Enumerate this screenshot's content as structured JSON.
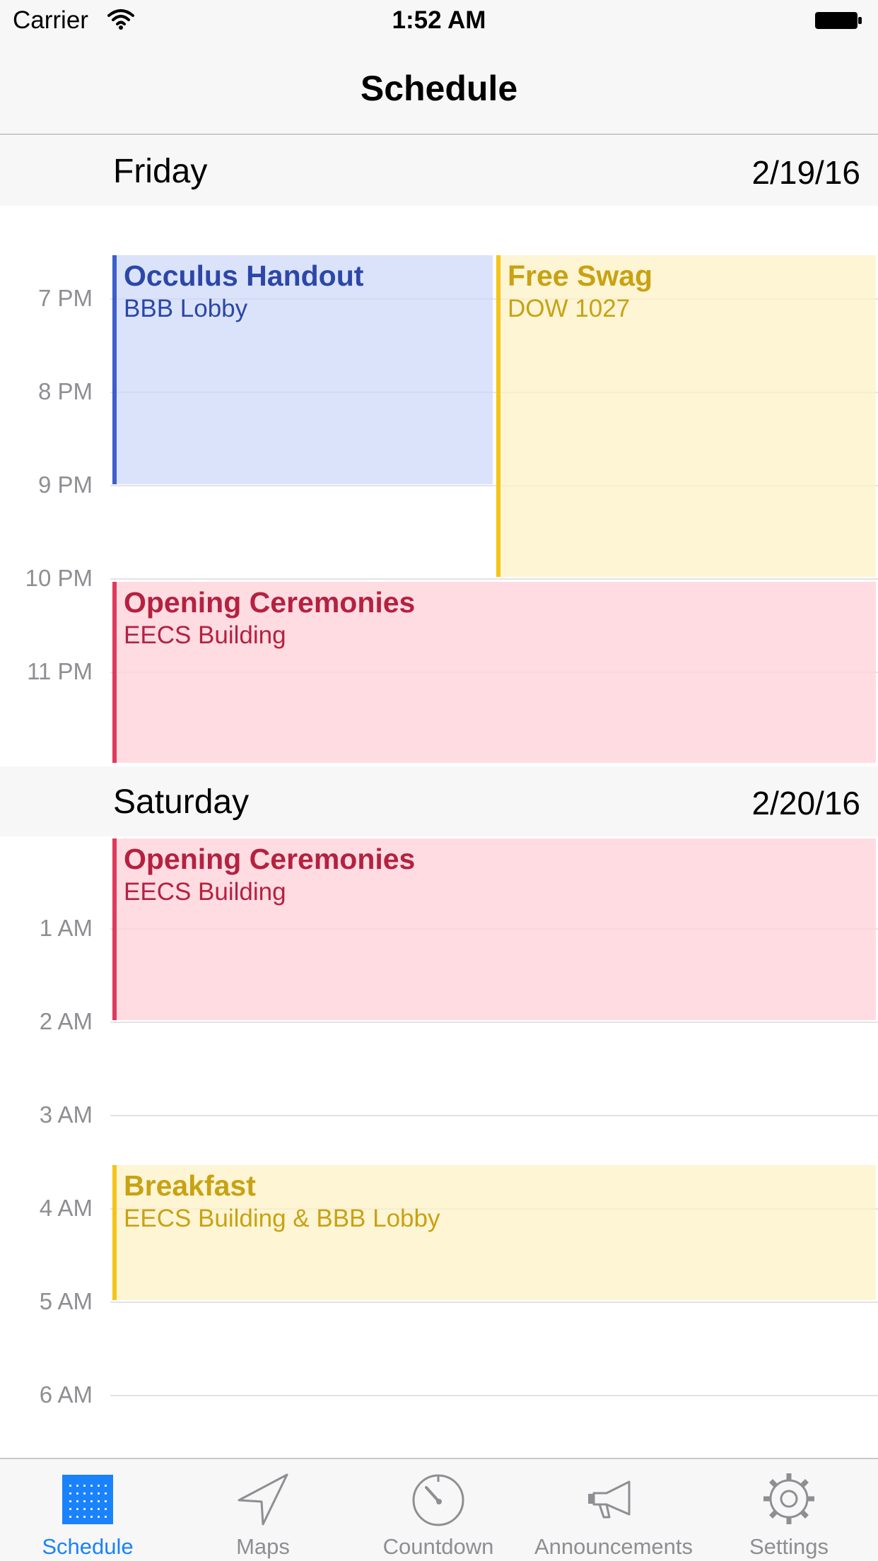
{
  "status_bar": {
    "carrier": "Carrier",
    "time": "1:52 AM"
  },
  "nav": {
    "title": "Schedule"
  },
  "days": [
    {
      "name": "Friday",
      "date": "2/19/16"
    },
    {
      "name": "Saturday",
      "date": "2/20/16"
    }
  ],
  "time_labels": [
    "7 PM",
    "8 PM",
    "9 PM",
    "10 PM",
    "11 PM",
    "1 AM",
    "2 AM",
    "3 AM",
    "4 AM",
    "5 AM",
    "6 AM"
  ],
  "events": [
    {
      "title": "Occulus Handout",
      "location": "BBB Lobby",
      "color": "#3c5fca"
    },
    {
      "title": "Free Swag",
      "location": "DOW 1027",
      "color": "#f4c419"
    },
    {
      "title": "Opening Ceremonies",
      "location": "EECS Building",
      "color": "#de3a5c"
    },
    {
      "title": "Opening Ceremonies",
      "location": "EECS Building",
      "color": "#de3a5c"
    },
    {
      "title": "Breakfast",
      "location": "EECS Building & BBB Lobby",
      "color": "#f4c419"
    }
  ],
  "tabs": [
    {
      "label": "Schedule",
      "icon": "calendar-grid-icon",
      "active": true
    },
    {
      "label": "Maps",
      "icon": "location-arrow-icon",
      "active": false
    },
    {
      "label": "Countdown",
      "icon": "timer-dial-icon",
      "active": false
    },
    {
      "label": "Announcements",
      "icon": "megaphone-icon",
      "active": false
    },
    {
      "label": "Settings",
      "icon": "gear-icon",
      "active": false
    }
  ],
  "colors": {
    "accent": "#1a82fb",
    "inactive": "#8e8e93"
  }
}
